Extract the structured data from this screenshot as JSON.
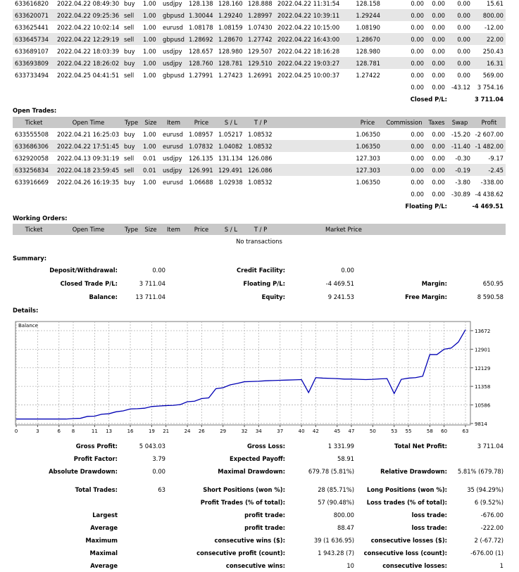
{
  "closed_trades": {
    "rows": [
      [
        "633616820",
        "2022.04.22 08:49:30",
        "buy",
        "1.00",
        "usdjpy",
        "128.138",
        "128.160",
        "128.888",
        "2022.04.22 11:31:54",
        "128.158",
        "0.00",
        "0.00",
        "0.00",
        "15.61"
      ],
      [
        "633620071",
        "2022.04.22 09:25:36",
        "sell",
        "1.00",
        "gbpusd",
        "1.30044",
        "1.29240",
        "1.28997",
        "2022.04.22 10:39:11",
        "1.29244",
        "0.00",
        "0.00",
        "0.00",
        "800.00"
      ],
      [
        "633625441",
        "2022.04.22 10:02:14",
        "sell",
        "1.00",
        "eurusd",
        "1.08178",
        "1.08159",
        "1.07430",
        "2022.04.22 10:15:00",
        "1.08190",
        "0.00",
        "0.00",
        "0.00",
        "-12.00"
      ],
      [
        "633645734",
        "2022.04.22 12:29:19",
        "sell",
        "1.00",
        "gbpusd",
        "1.28692",
        "1.28670",
        "1.27742",
        "2022.04.22 16:43:00",
        "1.28670",
        "0.00",
        "0.00",
        "0.00",
        "22.00"
      ],
      [
        "633689107",
        "2022.04.22 18:03:39",
        "buy",
        "1.00",
        "usdjpy",
        "128.657",
        "128.980",
        "129.507",
        "2022.04.22 18:16:28",
        "128.980",
        "0.00",
        "0.00",
        "0.00",
        "250.43"
      ],
      [
        "633693809",
        "2022.04.22 18:26:02",
        "buy",
        "1.00",
        "usdjpy",
        "128.760",
        "128.781",
        "129.510",
        "2022.04.22 19:03:27",
        "128.781",
        "0.00",
        "0.00",
        "0.00",
        "16.31"
      ],
      [
        "633733494",
        "2022.04.25 04:41:51",
        "sell",
        "1.00",
        "gbpusd",
        "1.27991",
        "1.27423",
        "1.26991",
        "2022.04.25 10:00:37",
        "1.27422",
        "0.00",
        "0.00",
        "0.00",
        "569.00"
      ]
    ],
    "totals": [
      "0.00",
      "0.00",
      "-43.12",
      "3 754.16"
    ],
    "closed_pl_label": "Closed P/L:",
    "closed_pl_value": "3 711.04"
  },
  "open_trades": {
    "title": "Open Trades:",
    "headers": [
      "Ticket",
      "Open Time",
      "Type",
      "Size",
      "Item",
      "Price",
      "S / L",
      "T / P",
      "",
      "Price",
      "Commission",
      "Taxes",
      "Swap",
      "Profit"
    ],
    "rows": [
      [
        "633555508",
        "2022.04.21 16:25:03",
        "buy",
        "1.00",
        "eurusd",
        "1.08957",
        "1.05217",
        "1.08532",
        "",
        "1.06350",
        "0.00",
        "0.00",
        "-15.20",
        "-2 607.00"
      ],
      [
        "633686306",
        "2022.04.22 17:51:45",
        "buy",
        "1.00",
        "eurusd",
        "1.07832",
        "1.04082",
        "1.08532",
        "",
        "1.06350",
        "0.00",
        "0.00",
        "-11.40",
        "-1 482.00"
      ],
      [
        "632920058",
        "2022.04.13 09:31:19",
        "sell",
        "0.01",
        "usdjpy",
        "126.135",
        "131.134",
        "126.086",
        "",
        "127.303",
        "0.00",
        "0.00",
        "-0.30",
        "-9.17"
      ],
      [
        "633256834",
        "2022.04.18 23:59:45",
        "sell",
        "0.01",
        "usdjpy",
        "126.991",
        "129.491",
        "126.086",
        "",
        "127.303",
        "0.00",
        "0.00",
        "-0.19",
        "-2.45"
      ],
      [
        "633916669",
        "2022.04.26 16:19:35",
        "buy",
        "1.00",
        "eurusd",
        "1.06688",
        "1.02938",
        "1.08532",
        "",
        "1.06350",
        "0.00",
        "0.00",
        "-3.80",
        "-338.00"
      ]
    ],
    "totals": [
      "0.00",
      "0.00",
      "-30.89",
      "-4 438.62"
    ],
    "floating_pl_label": "Floating P/L:",
    "floating_pl_value": "-4 469.51"
  },
  "working_orders": {
    "title": "Working Orders:",
    "headers": [
      "Ticket",
      "Open Time",
      "Type",
      "Size",
      "Item",
      "Price",
      "S / L",
      "T / P",
      "Market Price"
    ],
    "empty_text": "No transactions"
  },
  "summary": {
    "title": "Summary:",
    "deposit_label": "Deposit/Withdrawal:",
    "deposit_value": "0.00",
    "credit_label": "Credit Facility:",
    "credit_value": "0.00",
    "closed_label": "Closed Trade P/L:",
    "closed_value": "3 711.04",
    "floating_label": "Floating P/L:",
    "floating_value": "-4 469.51",
    "margin_label": "Margin:",
    "margin_value": "650.95",
    "balance_label": "Balance:",
    "balance_value": "13 711.04",
    "equity_label": "Equity:",
    "equity_value": "9 241.53",
    "free_margin_label": "Free Margin:",
    "free_margin_value": "8 590.58"
  },
  "details": {
    "title": "Details:"
  },
  "chart_data": {
    "type": "line",
    "series": [
      {
        "name": "Balance",
        "color": "#0000b4",
        "values": [
          10000,
          10000,
          10000,
          10000,
          10000,
          10000,
          10000,
          10000,
          10020,
          10030,
          10110,
          10120,
          10200,
          10220,
          10300,
          10340,
          10420,
          10430,
          10450,
          10520,
          10540,
          10560,
          10570,
          10600,
          10720,
          10740,
          10850,
          10880,
          11260,
          11300,
          11420,
          11480,
          11550,
          11560,
          11570,
          11590,
          11600,
          11610,
          11620,
          11630,
          11640,
          11100,
          11720,
          11700,
          11690,
          11680,
          11660,
          11660,
          11650,
          11640,
          11650,
          11670,
          11680,
          11060,
          11650,
          11700,
          11720,
          11780,
          12680,
          12680,
          12900,
          12950,
          13200,
          13711
        ]
      }
    ],
    "x_ticks": [
      "0",
      "3",
      "6",
      "8",
      "11",
      "13",
      "16",
      "19",
      "21",
      "24",
      "26",
      "29",
      "32",
      "34",
      "37",
      "40",
      "42",
      "45",
      "47",
      "50",
      "53",
      "55",
      "58",
      "60",
      "63"
    ],
    "y_ticks": [
      "13672",
      "12901",
      "12129",
      "11358",
      "10586",
      "9814"
    ],
    "ylim": [
      9814,
      13672
    ],
    "xlim": [
      0,
      63
    ],
    "grid": true
  },
  "stats": {
    "gross_profit_label": "Gross Profit:",
    "gross_profit_value": "5 043.03",
    "gross_loss_label": "Gross Loss:",
    "gross_loss_value": "1 331.99",
    "total_net_label": "Total Net Profit:",
    "total_net_value": "3 711.04",
    "profit_factor_label": "Profit Factor:",
    "profit_factor_value": "3.79",
    "expected_payoff_label": "Expected Payoff:",
    "expected_payoff_value": "58.91",
    "abs_dd_label": "Absolute Drawdown:",
    "abs_dd_value": "0.00",
    "max_dd_label": "Maximal Drawdown:",
    "max_dd_value": "679.78 (5.81%)",
    "rel_dd_label": "Relative Drawdown:",
    "rel_dd_value": "5.81% (679.78)",
    "total_trades_label": "Total Trades:",
    "total_trades_value": "63",
    "short_label": "Short Positions (won %):",
    "short_value": "28 (85.71%)",
    "long_label": "Long Positions (won %):",
    "long_value": "35 (94.29%)",
    "profit_trades_label": "Profit Trades (% of total):",
    "profit_trades_value": "57 (90.48%)",
    "loss_trades_label": "Loss trades (% of total):",
    "loss_trades_value": "6 (9.52%)",
    "largest_label": "Largest",
    "largest_pt_label": "profit trade:",
    "largest_pt_value": "800.00",
    "largest_lt_label": "loss trade:",
    "largest_lt_value": "-676.00",
    "average_label": "Average",
    "average_pt_label": "profit trade:",
    "average_pt_value": "88.47",
    "average_lt_label": "loss trade:",
    "average_lt_value": "-222.00",
    "maximum_label": "Maximum",
    "maximum_cw_label": "consecutive wins ($):",
    "maximum_cw_value": "39 (1 636.95)",
    "maximum_cl_label": "consecutive losses ($):",
    "maximum_cl_value": "2 (-67.72)",
    "maximal_label": "Maximal",
    "maximal_cp_label": "consecutive profit (count):",
    "maximal_cp_value": "1 943.28 (7)",
    "maximal_cl_label": "consecutive loss (count):",
    "maximal_cl_value": "-676.00 (1)",
    "average2_label": "Average",
    "average2_cw_label": "consecutive wins:",
    "average2_cw_value": "10",
    "average2_cl_label": "consecutive losses:",
    "average2_cl_value": "1"
  }
}
